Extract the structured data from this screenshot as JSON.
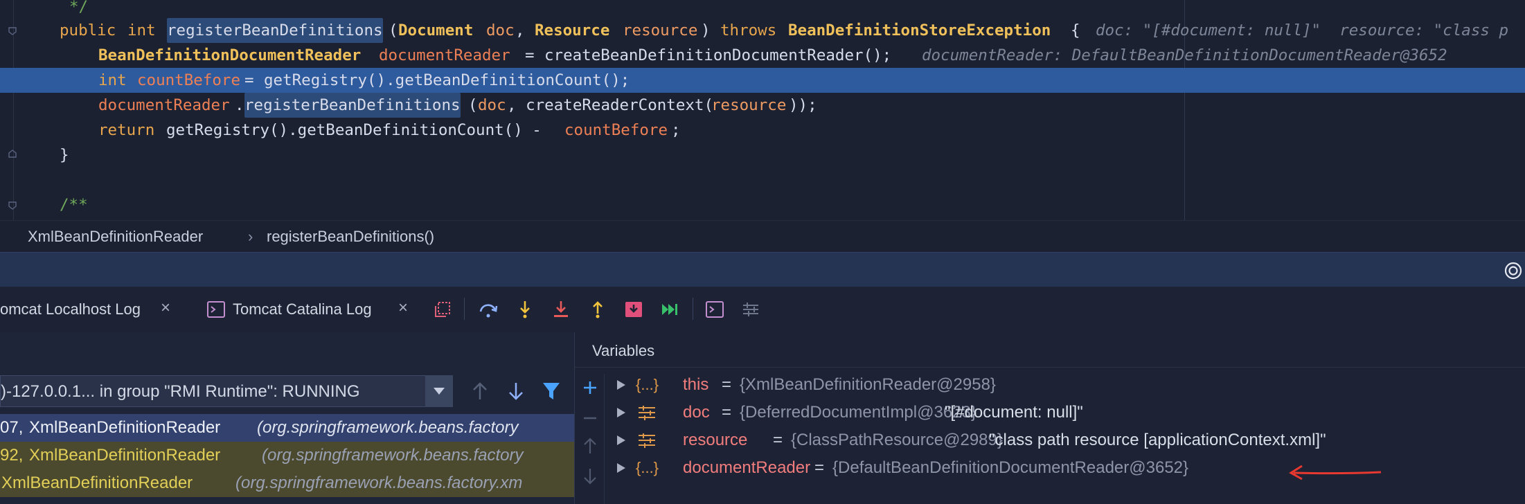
{
  "editor": {
    "lines": [
      {
        "comment": "*/"
      },
      {
        "kw_public": "public",
        "kw_int": "int",
        "method": "registerBeanDefinitions",
        "p_open": "(",
        "t_document": "Document",
        "p_doc": "doc",
        "comma": ",",
        "t_resource": "Resource",
        "p_resource": "resource",
        "p_close": ")",
        "kw_throws": "throws",
        "t_exception": "BeanDefinitionStoreException",
        "brace": "{",
        "hint": "doc: \"[#document: null]\"  resource: \"class p"
      },
      {
        "t_reader": "BeanDefinitionDocumentReader",
        "v_reader": "documentReader",
        "assign": "=",
        "call": "createBeanDefinitionDocumentReader();",
        "hint": "documentReader: DefaultBeanDefinitionDocumentReader@3652"
      },
      {
        "kw_int": "int",
        "v_count": "countBefore",
        "assign": "=",
        "call": "getRegistry().getBeanDefinitionCount();"
      },
      {
        "v_reader": "documentReader",
        "dot": ".",
        "method": "registerBeanDefinitions",
        "p_open": "(",
        "a_doc": "doc",
        "mid": ", createReaderContext(",
        "a_res": "resource",
        "end": "));"
      },
      {
        "kw_return": "return",
        "call": "getRegistry().getBeanDefinitionCount() -",
        "v_count": "countBefore",
        "semi": ";"
      },
      {
        "brace": "}"
      },
      {
        "comment": "/**"
      }
    ]
  },
  "breadcrumb": {
    "class_name": "XmlBeanDefinitionReader",
    "separator": "›",
    "method": "registerBeanDefinitions()"
  },
  "tabs": [
    {
      "label": "omcat Localhost Log",
      "close": "×"
    },
    {
      "label": "Tomcat Catalina Log",
      "close": "×"
    }
  ],
  "frames": {
    "thread": ")-127.0.0.1... in group \"RMI Runtime\": RUNNING",
    "rows": [
      {
        "line": "07,",
        "cls": "XmlBeanDefinitionReader",
        "pkg": "(org.springframework.beans.factory"
      },
      {
        "line": "92,",
        "cls": "XmlBeanDefinitionReader",
        "pkg": "(org.springframework.beans.factory"
      },
      {
        "line": "",
        "cls": "XmlBeanDefinitionReader",
        "pkg": "(org.springframework.beans.factory.xm"
      }
    ]
  },
  "variables": {
    "title": "Variables",
    "rows": [
      {
        "name": "this",
        "eq": "=",
        "type": "{XmlBeanDefinitionReader@2958}",
        "value": ""
      },
      {
        "name": "doc",
        "eq": "=",
        "type": "{DeferredDocumentImpl@3623}",
        "value": "\"[#document: null]\""
      },
      {
        "name": "resource",
        "eq": "=",
        "type": "{ClassPathResource@2989}",
        "value": "\"class path resource [applicationContext.xml]\""
      },
      {
        "name": "documentReader",
        "eq": "=",
        "type": "{DefaultBeanDefinitionDocumentReader@3652}",
        "value": ""
      }
    ]
  },
  "colors": {
    "accent_selection": "#2e5a9e",
    "annotation_arrow": "#e8382f"
  }
}
